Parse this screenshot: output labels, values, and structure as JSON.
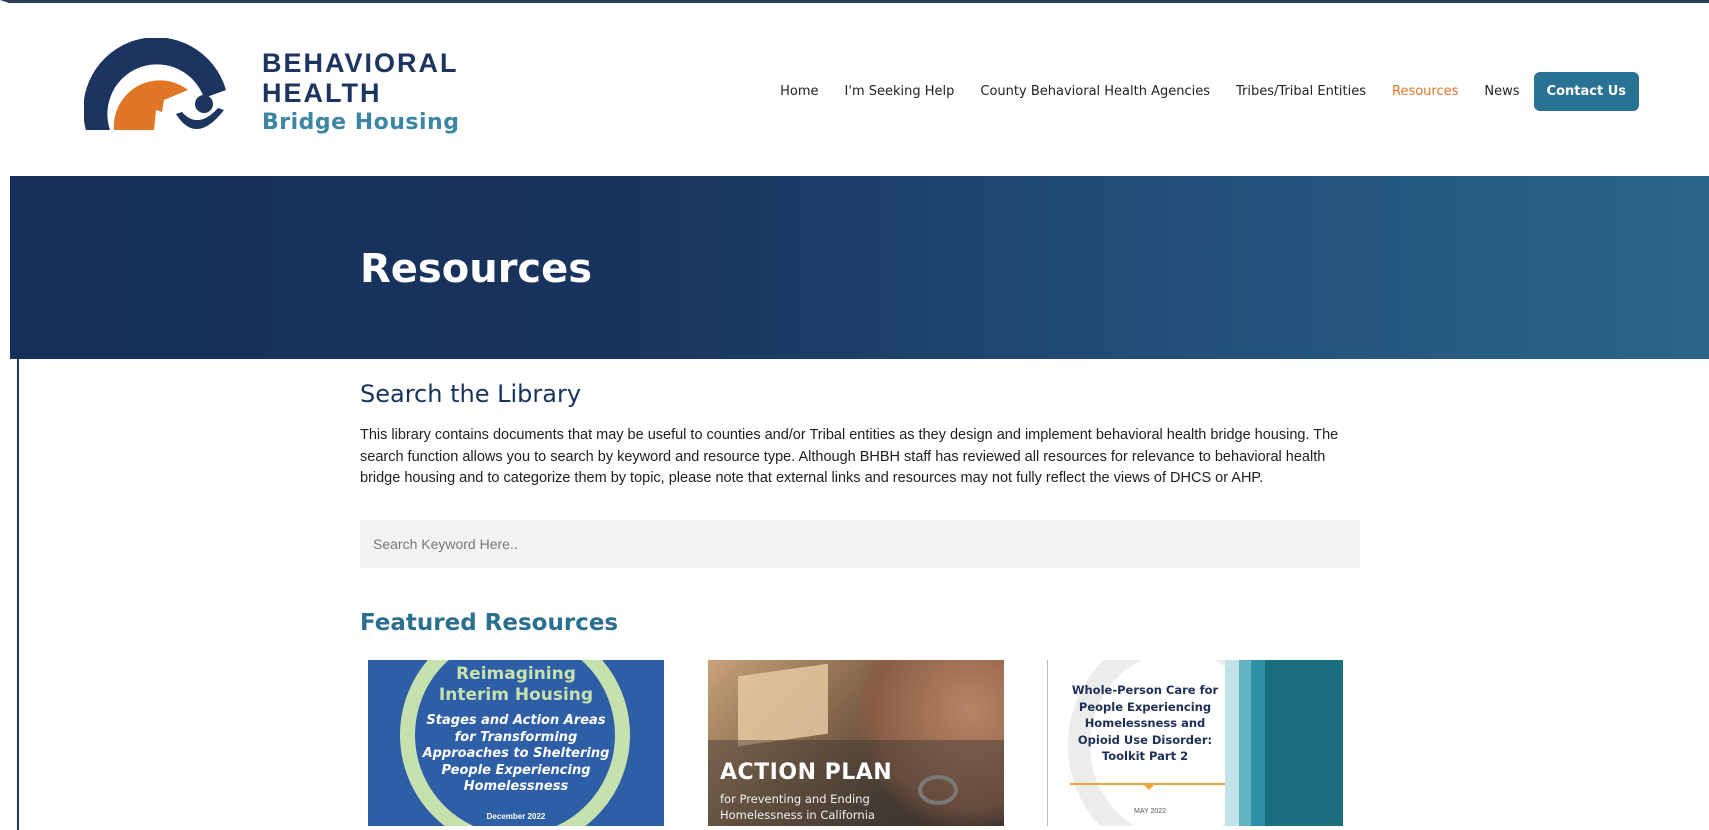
{
  "logo": {
    "line1": "BEHAVIORAL",
    "line2": "HEALTH",
    "line3": "Bridge Housing",
    "colors": {
      "navy": "#1c3460",
      "orange": "#e07727",
      "teal": "#3b86a2"
    }
  },
  "nav": {
    "items": [
      {
        "label": "Home"
      },
      {
        "label": "I'm Seeking Help"
      },
      {
        "label": "County Behavioral Health Agencies"
      },
      {
        "label": "Tribes/Tribal Entities"
      },
      {
        "label": "Resources",
        "active": true
      },
      {
        "label": "News"
      }
    ],
    "contact_label": "Contact Us",
    "active_color": "#e07727",
    "contact_bg": "#2a7294"
  },
  "hero": {
    "title": "Resources"
  },
  "library": {
    "heading": "Search the Library",
    "intro": "This library contains documents that may be useful to counties and/or Tribal entities as they design and implement behavioral health bridge housing. The search function allows you to search by keyword and resource type. Although BHBH staff has reviewed all resources for relevance to behavioral health bridge housing and to categorize them by topic, please note that external links and resources may not fully reflect the views of DHCS or AHP.",
    "search_placeholder": "Search Keyword Here.."
  },
  "featured": {
    "heading": "Featured Resources",
    "cards": [
      {
        "title_line1": "Reimagining",
        "title_line2": "Interim Housing",
        "subtitle_lines": [
          "Stages and Action Areas",
          "for Transforming",
          "Approaches to Sheltering",
          "People Experiencing",
          "Homelessness"
        ],
        "date": "December 2022"
      },
      {
        "title": "ACTION PLAN",
        "subtitle_line1": "for Preventing and Ending",
        "subtitle_line2": "Homelessness in California"
      },
      {
        "title_lines": [
          "Whole-Person Care for",
          "People Experiencing",
          "Homelessness and",
          "Opioid Use Disorder:",
          "Toolkit Part 2"
        ],
        "date": "MAY 2022",
        "stripe_colors": [
          "#bfe3e6",
          "#62b3c2",
          "#2f8fa4",
          "#1b6e7d"
        ]
      }
    ]
  }
}
